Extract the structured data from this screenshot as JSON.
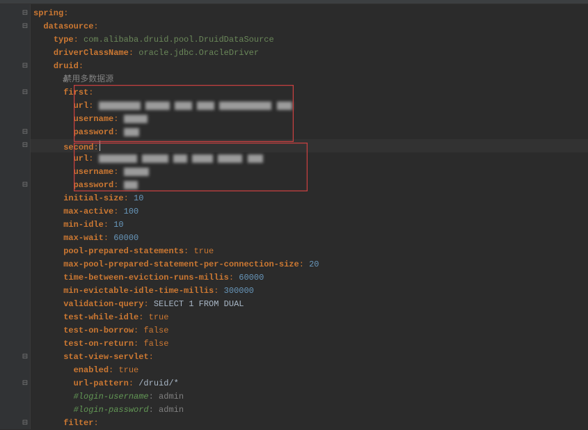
{
  "code": {
    "l1_key": "spring",
    "l2_key": "datasource",
    "l3_key": "type",
    "l3_val": "com.alibaba.druid.pool.DruidDataSource",
    "l4_key": "driverClassName",
    "l4_val": "oracle.jdbc.OracleDriver",
    "l5_key": "druid",
    "l6_comment": "禁用多数据源",
    "l7_key": "first",
    "l8_key": "url",
    "l9_key": "username",
    "l10_key": "password",
    "l11_key": "second",
    "l12_key": "url",
    "l13_key": "username",
    "l14_key": "password",
    "l15_key": "initial-size",
    "l15_val": "10",
    "l16_key": "max-active",
    "l16_val": "100",
    "l17_key": "min-idle",
    "l17_val": "10",
    "l18_key": "max-wait",
    "l18_val": "60000",
    "l19_key": "pool-prepared-statements",
    "l19_val": "true",
    "l20_key": "max-pool-prepared-statement-per-connection-size",
    "l20_val": "20",
    "l21_key": "time-between-eviction-runs-millis",
    "l21_val": "60000",
    "l22_key": "min-evictable-idle-time-millis",
    "l22_val": "300000",
    "l23_key": "validation-query",
    "l23_val": "SELECT 1 FROM DUAL",
    "l24_key": "test-while-idle",
    "l24_val": "true",
    "l25_key": "test-on-borrow",
    "l25_val": "false",
    "l26_key": "test-on-return",
    "l26_val": "false",
    "l27_key": "stat-view-servlet",
    "l28_key": "enabled",
    "l28_val": "true",
    "l29_key": "url-pattern",
    "l29_val": "/druid/*",
    "l30_comment_key": "#login-username",
    "l30_comment_val": "admin",
    "l31_comment_key": "#login-password",
    "l31_comment_val": "admin",
    "l32_key": "filter"
  },
  "hash": "#"
}
